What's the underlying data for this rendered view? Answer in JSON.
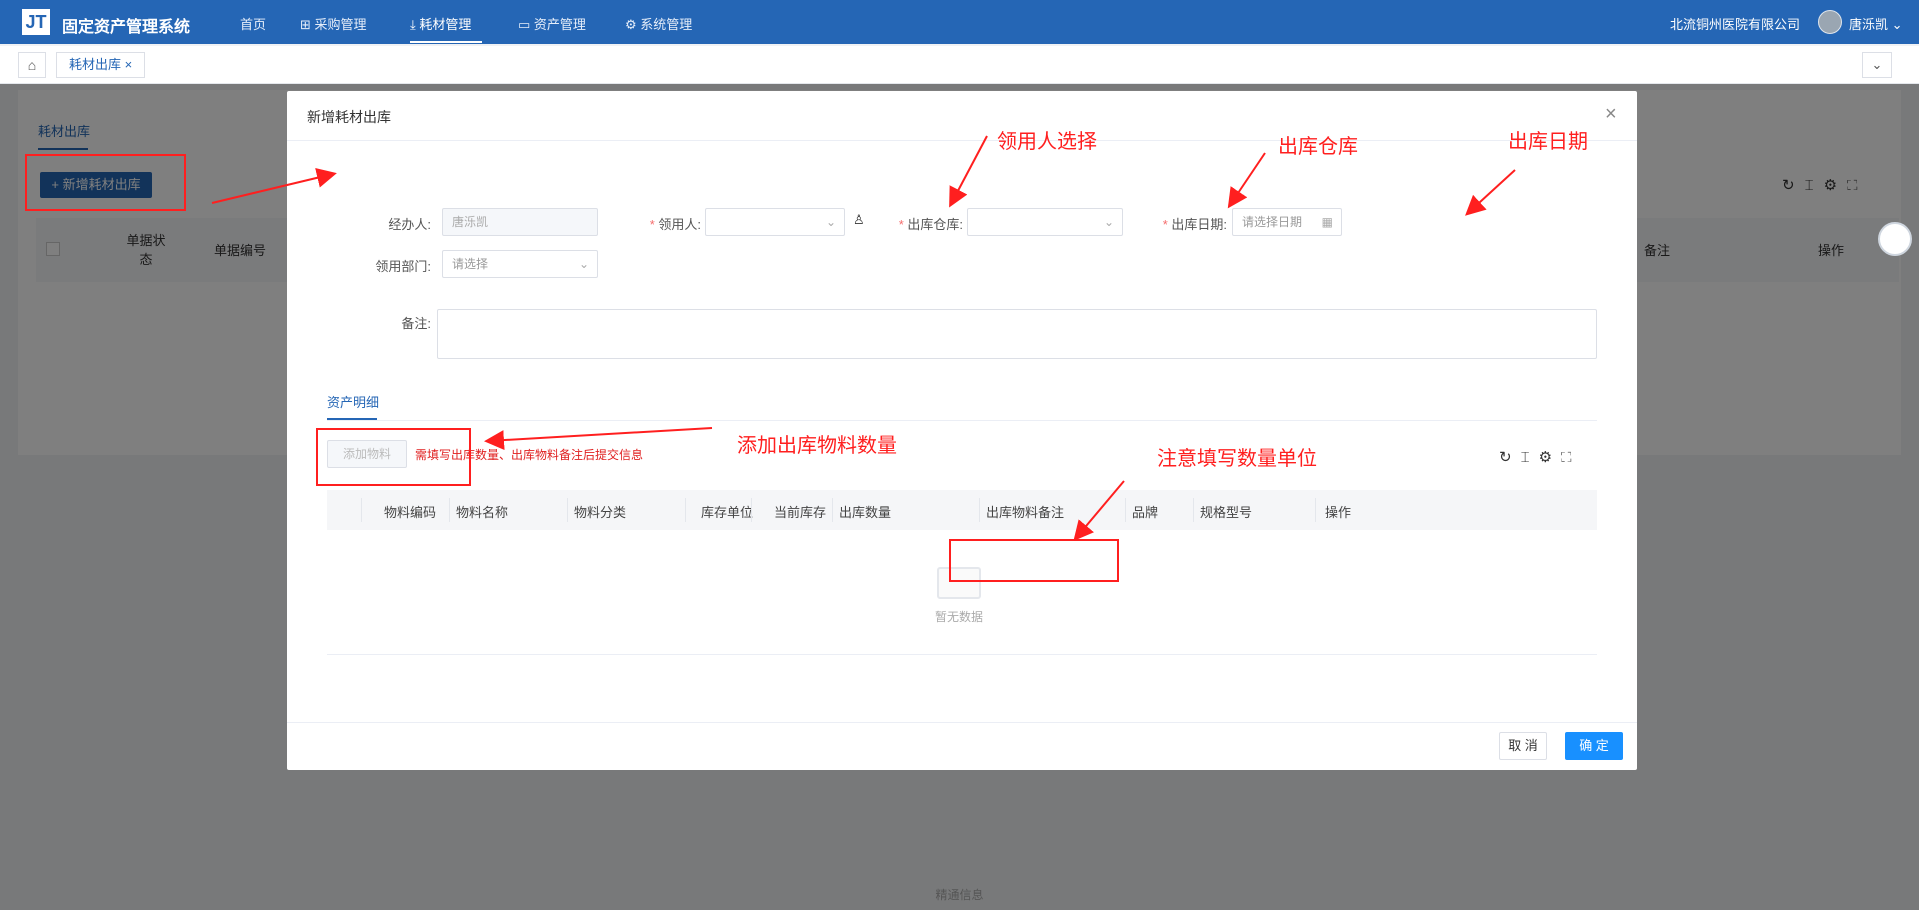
{
  "topbar": {
    "logo": "JT",
    "title": "固定资产管理系统",
    "nav": [
      "首页",
      "采购管理",
      "耗材管理",
      "资产管理",
      "系统管理"
    ],
    "active_nav": "耗材管理",
    "org": "北流铜州医院有限公司",
    "user": "唐泺凯"
  },
  "tabs": {
    "current": "耗材出库"
  },
  "page": {
    "tab": "耗材出库",
    "add_button": "+ 新增耗材出库",
    "columns": [
      "单据状态",
      "单据编号",
      "备注",
      "操作"
    ],
    "footer": "精通信息"
  },
  "dialog": {
    "title": "新增耗材出库",
    "handler_label": "经办人:",
    "handler_value": "唐泺凯",
    "receiver_label": "领用人:",
    "warehouse_label": "出库仓库:",
    "date_label": "出库日期:",
    "date_placeholder": "请选择日期",
    "dept_label": "领用部门:",
    "dept_placeholder": "请选择",
    "remark_label": "备注:",
    "subtab": "资产明细",
    "add_material": "添加物料",
    "hint": "需填写出库数量、出库物料备注后提交信息",
    "table_columns": [
      "物料编码",
      "物料名称",
      "物料分类",
      "库存单位",
      "当前库存",
      "出库数量",
      "出库物料备注",
      "品牌",
      "规格型号",
      "操作"
    ],
    "empty_text": "暂无数据",
    "cancel": "取 消",
    "confirm": "确 定"
  },
  "annotations": {
    "receiver": "领用人选择",
    "warehouse": "出库仓库",
    "date": "出库日期",
    "add_quantity": "添加出库物料数量",
    "unit_note": "注意填写数量单位"
  },
  "colors": {
    "primary": "#2566b5",
    "button": "#1890ff",
    "annotation": "#ff1f1f"
  }
}
